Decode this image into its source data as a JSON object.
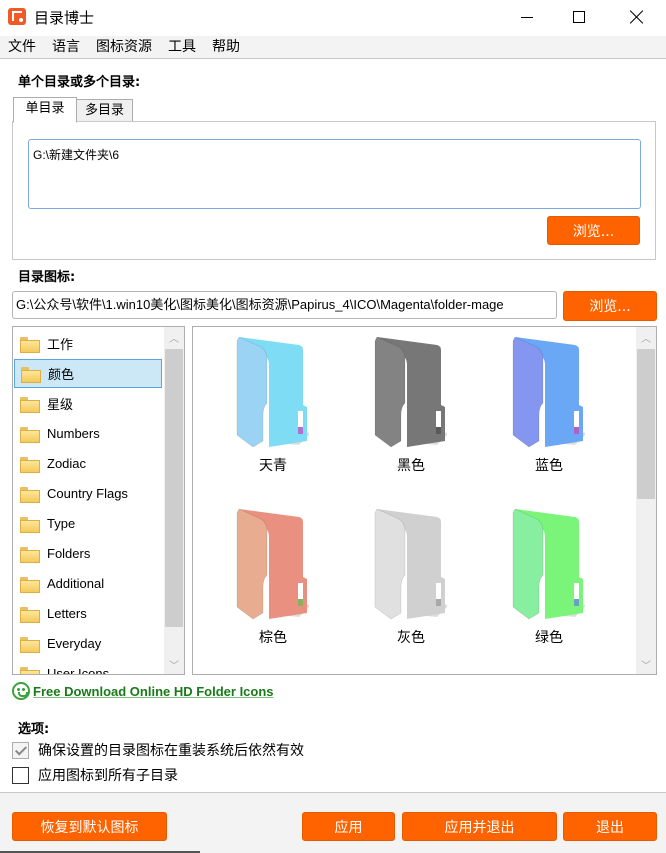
{
  "window": {
    "title": "目录博士",
    "controls": {
      "minimize": "minimize",
      "maximize": "maximize",
      "close": "close"
    }
  },
  "menu": [
    "文件",
    "语言",
    "图标资源",
    "工具",
    "帮助"
  ],
  "directories": {
    "label": "单个目录或多个目录:",
    "tabs": [
      {
        "label": "单目录",
        "active": true
      },
      {
        "label": "多目录",
        "active": false
      }
    ],
    "value": "G:\\新建文件夹\\6",
    "browse_label": "浏览..."
  },
  "icon": {
    "label": "目录图标:",
    "path": "G:\\公众号\\软件\\1.win10美化\\图标美化\\图标资源\\Papirus_4\\ICO\\Magenta\\folder-mage",
    "browse_label": "浏览..."
  },
  "categories": {
    "selected": "颜色",
    "items": [
      "工作",
      "颜色",
      "星级",
      "Numbers",
      "Zodiac",
      "Country Flags",
      "Type",
      "Folders",
      "Additional",
      "Letters",
      "Everyday",
      "User Icons"
    ]
  },
  "icons": [
    {
      "label": "天青",
      "color": "#7fdcf5",
      "side": "#9ad3f3",
      "tag": "#b070d0"
    },
    {
      "label": "黑色",
      "color": "#777777",
      "side": "#838383",
      "tag": "#5a5a5a"
    },
    {
      "label": "蓝色",
      "color": "#6aa8f5",
      "side": "#8496f0",
      "tag": "#b060c8"
    },
    {
      "label": "棕色",
      "color": "#e99080",
      "side": "#e8ad90",
      "tag": "#8ab060"
    },
    {
      "label": "灰色",
      "color": "#d0d0d0",
      "side": "#e0e0e0",
      "tag": "#a8a8a8"
    },
    {
      "label": "绿色",
      "color": "#7af57a",
      "side": "#88eea0",
      "tag": "#6aa0c8"
    }
  ],
  "link": {
    "text": "Free Download Online HD Folder Icons"
  },
  "options": {
    "label": "选项:",
    "items": [
      {
        "label": "确保设置的目录图标在重装系统后依然有效",
        "checked": true
      },
      {
        "label": "应用图标到所有子目录",
        "checked": false
      }
    ]
  },
  "footer": {
    "restore_label": "恢复到默认图标",
    "apply_label": "应用",
    "apply_exit_label": "应用并退出",
    "exit_label": "退出"
  }
}
